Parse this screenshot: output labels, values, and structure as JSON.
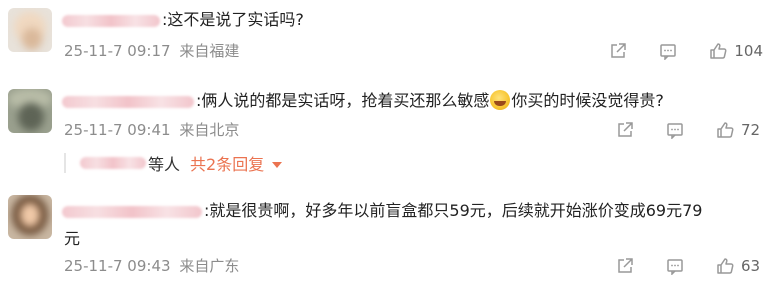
{
  "comments": [
    {
      "text": ":这不是说了实话吗?",
      "time": "25-11-7 09:17",
      "location": "来自福建",
      "likes": "104"
    },
    {
      "text_before_emoji": ":俩人说的都是实话呀，抢着买还那么敏感",
      "text_after_emoji": "你买的时候没觉得贵?",
      "time": "25-11-7 09:41",
      "location": "来自北京",
      "likes": "72",
      "replies": {
        "suffix": "等人",
        "more": "共2条回复"
      }
    },
    {
      "line1": ":就是很贵啊，好多年以前盲盒都只59元，后续就开始涨价变成69元79",
      "line2": "元",
      "time": "25-11-7 09:43",
      "location": "来自广东",
      "likes": "63"
    }
  ],
  "icons": {
    "share": "share-icon",
    "reply": "comment-icon",
    "like": "thumbs-up-icon",
    "expand": "triangle-down-icon"
  },
  "colors": {
    "accent": "#eb7350",
    "meta": "#8c8c8c"
  }
}
